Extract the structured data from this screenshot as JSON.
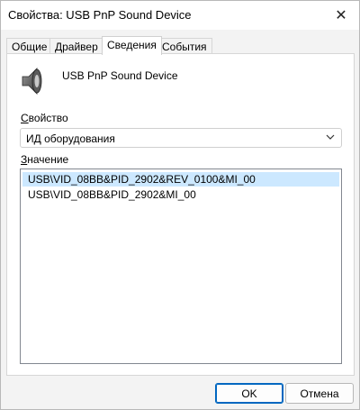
{
  "window": {
    "title": "Свойства: USB PnP Sound Device",
    "close_glyph": "✕"
  },
  "tabs": [
    {
      "label": "Общие",
      "active": false
    },
    {
      "label": "Драйвер",
      "active": false
    },
    {
      "label": "Сведения",
      "active": true
    },
    {
      "label": "События",
      "active": false
    }
  ],
  "device": {
    "name": "USB PnP Sound Device",
    "icon": "speaker-icon"
  },
  "property": {
    "label_accel": "С",
    "label_rest": "войство",
    "selected_value": "ИД оборудования"
  },
  "value": {
    "label_accel": "З",
    "label_rest": "начение",
    "items": [
      {
        "text": "USB\\VID_08BB&PID_2902&REV_0100&MI_00",
        "selected": true
      },
      {
        "text": "USB\\VID_08BB&PID_2902&MI_00",
        "selected": false
      }
    ]
  },
  "buttons": {
    "ok": "OK",
    "cancel": "Отмена"
  },
  "colors": {
    "accent": "#0067c0",
    "selection": "#cce8ff"
  }
}
